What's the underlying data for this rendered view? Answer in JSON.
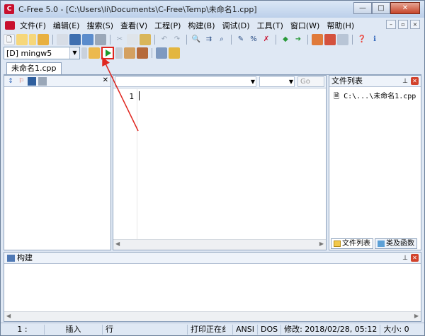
{
  "window": {
    "title": "C-Free 5.0 - [C:\\Users\\li\\Documents\\C-Free\\Temp\\未命名1.cpp]",
    "app_icon_letter": "C"
  },
  "title_buttons": {
    "minimize": "—",
    "maximize": "□",
    "close": "✕"
  },
  "menu": {
    "items": [
      "文件(F)",
      "编辑(E)",
      "搜索(S)",
      "查看(V)",
      "工程(P)",
      "构建(B)",
      "调试(D)",
      "工具(T)",
      "窗口(W)",
      "帮助(H)"
    ]
  },
  "mdi_buttons": [
    "–",
    "▫",
    "×"
  ],
  "compiler": {
    "selected": "[D] mingw5"
  },
  "document_tab": {
    "label": "未命名1.cpp"
  },
  "editor": {
    "line_numbers": [
      "1"
    ],
    "go_button": "Go"
  },
  "right_panel": {
    "title": "文件列表",
    "file": "C:\\...\\未命名1.cpp",
    "tabs": [
      "文件列表",
      "类及函数"
    ]
  },
  "build_panel": {
    "title": "构建"
  },
  "status": {
    "position": "1 :",
    "insert": "插入",
    "line_col": "行",
    "printing": "打印正在纟",
    "encoding": "ANSI",
    "line_ending": "DOS",
    "modified": "修改: 2018/02/28, 05:12",
    "size": "大小: 0"
  },
  "colors": {
    "highlight": "#e0261f",
    "run": "#1d9b2b"
  }
}
